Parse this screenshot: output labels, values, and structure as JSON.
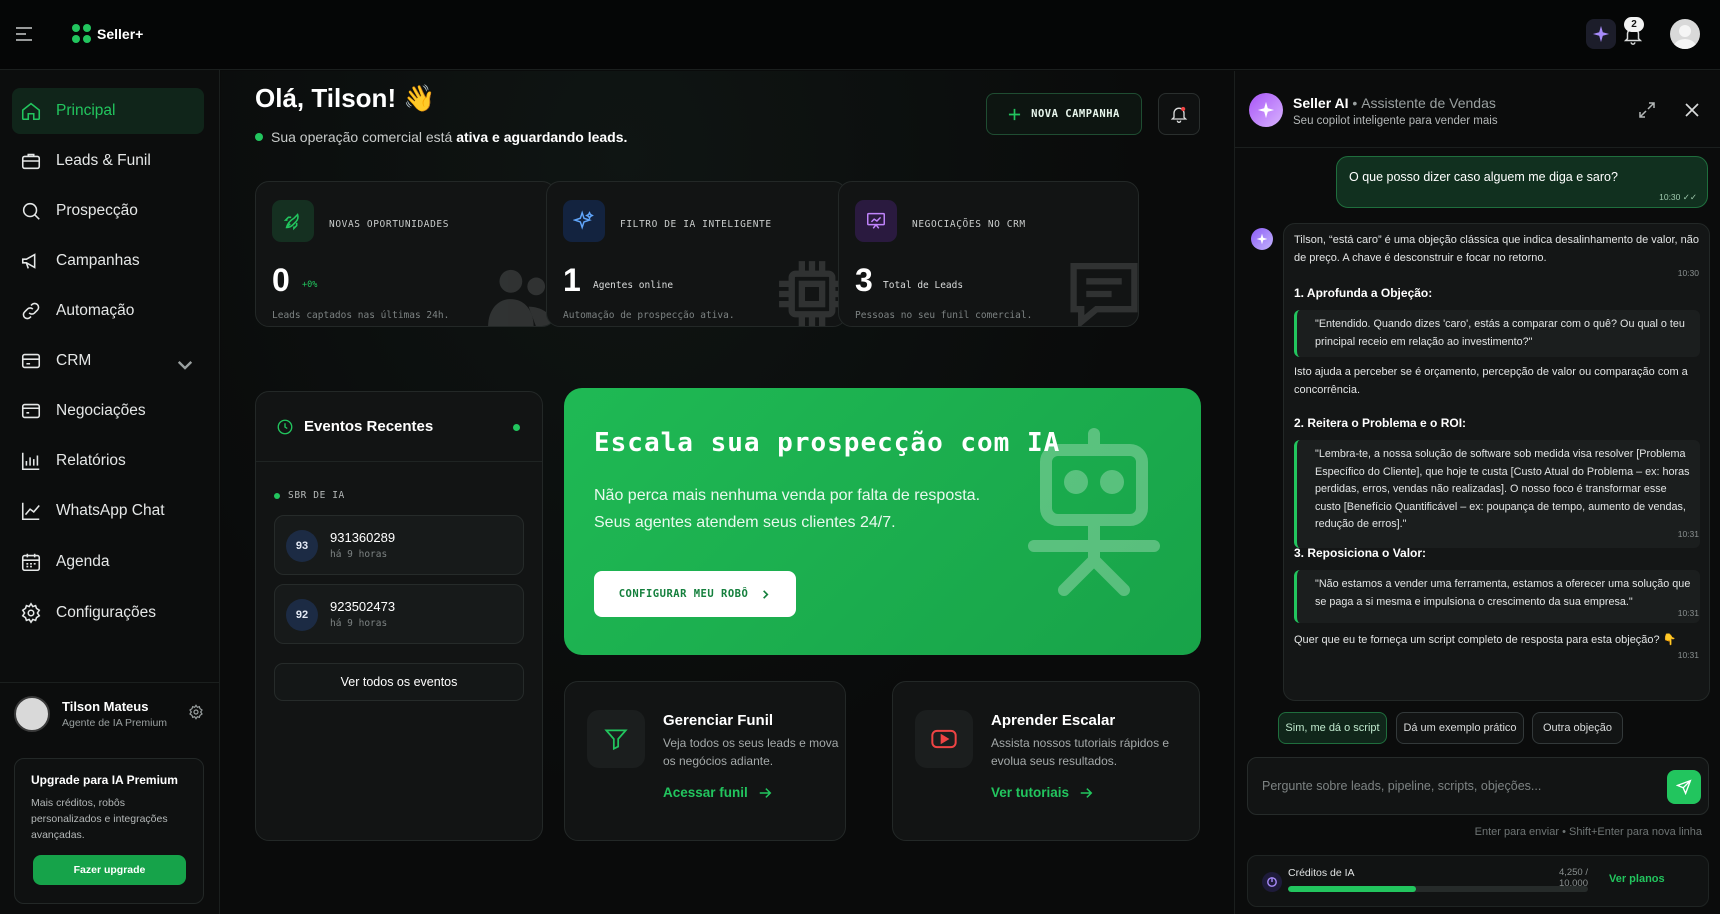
{
  "app": {
    "name": "Seller+",
    "notifications": "2"
  },
  "sidebar": {
    "items": [
      {
        "label": "Principal"
      },
      {
        "label": "Leads & Funil"
      },
      {
        "label": "Prospecção"
      },
      {
        "label": "Campanhas"
      },
      {
        "label": "Automação"
      },
      {
        "label": "CRM"
      },
      {
        "label": "Negociações"
      },
      {
        "label": "Relatórios"
      },
      {
        "label": "WhatsApp Chat"
      },
      {
        "label": "Agenda"
      },
      {
        "label": "Configurações"
      }
    ],
    "user": {
      "name": "Tilson Mateus",
      "role": "Agente de IA Premium"
    },
    "upgrade": {
      "title": "Upgrade para IA Premium",
      "description": "Mais créditos, robôs personalizados e integrações avançadas.",
      "button": "Fazer upgrade"
    }
  },
  "main": {
    "greeting": "Olá, Tilson! 👋",
    "status_prefix": "Sua operação comercial está",
    "status_bold": "ativa e aguardando leads.",
    "new_campaign": "NOVA CAMPANHA",
    "stats": [
      {
        "label": "NOVAS OPORTUNIDADES",
        "value": "0",
        "aux": "+0%",
        "sub": "Leads captados nas últimas 24h."
      },
      {
        "label": "FILTRO DE IA INTELIGENTE",
        "value": "1",
        "aux": "Agentes online",
        "sub": "Automação de prospecção ativa."
      },
      {
        "label": "NEGOCIAÇÕES NO CRM",
        "value": "3",
        "aux": "Total de Leads",
        "sub": "Pessoas no seu funil comercial."
      }
    ],
    "events": {
      "title": "Eventos Recentes",
      "section": "SBR DE IA",
      "items": [
        {
          "avatar": "93",
          "number": "931360289",
          "time": "há 9 horas"
        },
        {
          "avatar": "92",
          "number": "923502473",
          "time": "há 9 horas"
        }
      ],
      "view_all": "Ver todos os eventos"
    },
    "hero": {
      "title": "Escala sua prospecção com IA",
      "line1": "Não perca mais nenhuma venda por falta de resposta.",
      "line2": "Seus agentes atendem seus clientes 24/7.",
      "button": "CONFIGURAR MEU ROBÔ"
    },
    "cards": [
      {
        "title": "Gerenciar Funil",
        "description": "Veja todos os seus leads e mova os negócios adiante.",
        "link": "Acessar funil"
      },
      {
        "title": "Aprender Escalar",
        "description": "Assista nossos tutoriais rápidos e evolua seus resultados.",
        "link": "Ver tutoriais"
      }
    ]
  },
  "chat": {
    "title": "Seller AI",
    "subtitle_tag": "Assistente de Vendas",
    "subtitle": "Seu copilot inteligente para vender mais",
    "user_message": {
      "text": "O que posso dizer caso alguem me diga e saro?",
      "time": "10:30"
    },
    "ai": {
      "intro": "Tilson, “está caro” é uma objeção clássica que indica desalinhamento de valor, não de preço. A chave é desconstruir e focar no retorno.",
      "intro_time": "10:30",
      "h1": "1. Aprofunda a Objeção:",
      "q1": "\"Entendido. Quando dizes 'caro', estás a comparar com o quê? Ou qual o teu principal receio em relação ao investimento?\"",
      "p1": "Isto ajuda a perceber se é orçamento, percepção de valor ou comparação com a concorrência.",
      "h2": "2. Reitera o Problema e o ROI:",
      "q2": "\"Lembra-te, a nossa solução de software sob medida visa resolver [Problema Específico do Cliente], que hoje te custa [Custo Atual do Problema – ex: horas perdidas, erros, vendas não realizadas]. O nosso foco é transformar esse custo [Benefício Quantificável – ex: poupança de tempo, aumento de vendas, redução de erros].\"",
      "q2_time": "10:31",
      "h3": "3. Reposiciona o Valor:",
      "q3": "\"Não estamos a vender uma ferramenta, estamos a oferecer uma solução que se paga a si mesma e impulsiona o crescimento da sua empresa.\"",
      "q3_time": "10:31",
      "closing": "Quer que eu te forneça um script completo de resposta para esta objeção? 👇",
      "closing_time": "10:31"
    },
    "suggestions": [
      "Sim, me dá o script",
      "Dá um exemplo prático",
      "Outra objeção"
    ],
    "input_placeholder": "Pergunte sobre leads, pipeline, scripts, objeções...",
    "hint": "Enter para enviar • Shift+Enter para nova linha",
    "credits": {
      "label": "Créditos de IA",
      "value": "4,250 / 10,000",
      "used_fraction": 0.425,
      "link": "Ver planos"
    }
  },
  "colors": {
    "accent": "#22c55e",
    "hero": "#1fb954",
    "ai": "#a855f7"
  }
}
